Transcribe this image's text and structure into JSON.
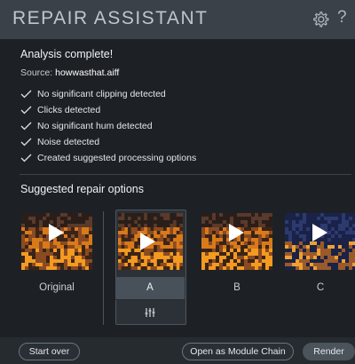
{
  "header": {
    "title": "REPAIR ASSISTANT",
    "settings_icon": "gear-icon",
    "help_glyph": "?"
  },
  "analysis": {
    "title": "Analysis complete!",
    "source_label": "Source:",
    "source_file": "howwasthat.aiff",
    "checks": [
      "No significant clipping detected",
      "Clicks detected",
      "No significant hum detected",
      "Noise detected",
      "Created suggested processing options"
    ]
  },
  "suggested": {
    "title": "Suggested repair options",
    "options": [
      {
        "label": "Original",
        "selected": false
      },
      {
        "label": "A",
        "selected": true
      },
      {
        "label": "B",
        "selected": false
      },
      {
        "label": "C",
        "selected": false
      }
    ]
  },
  "footer": {
    "start_over": "Start over",
    "open_module_chain": "Open as Module Chain",
    "render": "Render"
  },
  "colors": {
    "titlebar": "#3a4149",
    "background": "#1d2125",
    "spectrogram_warm": "#e8861c",
    "spectrogram_cool": "#23305a"
  }
}
